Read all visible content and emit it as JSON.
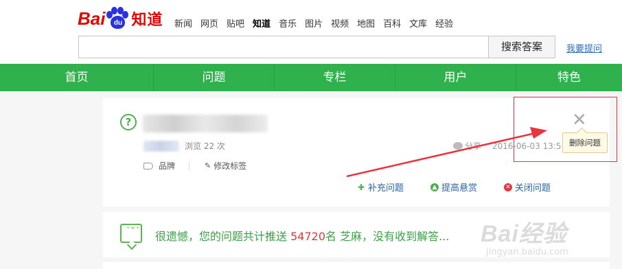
{
  "logo": {
    "left_text": "Bai",
    "paw_text": "du",
    "brand": "知道"
  },
  "topnav": [
    {
      "label": "新闻",
      "active": false
    },
    {
      "label": "网页",
      "active": false
    },
    {
      "label": "贴吧",
      "active": false
    },
    {
      "label": "知道",
      "active": true
    },
    {
      "label": "音乐",
      "active": false
    },
    {
      "label": "图片",
      "active": false
    },
    {
      "label": "视频",
      "active": false
    },
    {
      "label": "地图",
      "active": false
    },
    {
      "label": "百科",
      "active": false
    },
    {
      "label": "文库",
      "active": false
    },
    {
      "label": "经验",
      "active": false
    }
  ],
  "search": {
    "value": "",
    "button_label": "搜索答案",
    "ask_link": "我要提问"
  },
  "greenbar": [
    "首页",
    "问题",
    "专栏",
    "用户",
    "特色"
  ],
  "question": {
    "views": "浏览 22 次",
    "tag": "品牌",
    "edit_tags": "修改标签",
    "share_label": "分享",
    "datetime": "2016-06-03 13:5"
  },
  "actions": [
    {
      "label": "补充问题",
      "icon": "add-icon",
      "color": "#4cb04f"
    },
    {
      "label": "提高悬赏",
      "icon": "arrow-up-icon",
      "color": "#4cb04f"
    },
    {
      "label": "关闭问题",
      "icon": "close-circle-icon",
      "color": "#e4363b"
    }
  ],
  "tooltip": {
    "label": "删除问题"
  },
  "notice": {
    "prefix": "很遗憾，您的问题共计推送 ",
    "count": "54720",
    "suffix": "名 芝麻，没有收到解答..."
  },
  "watermark": {
    "logo": "Bai经验",
    "url": "jingyan.baidu.com"
  },
  "colors": {
    "brand_red": "#e10602",
    "brand_blue": "#2932e1",
    "green": "#2fb24e",
    "annotation_red": "#e8343a"
  }
}
